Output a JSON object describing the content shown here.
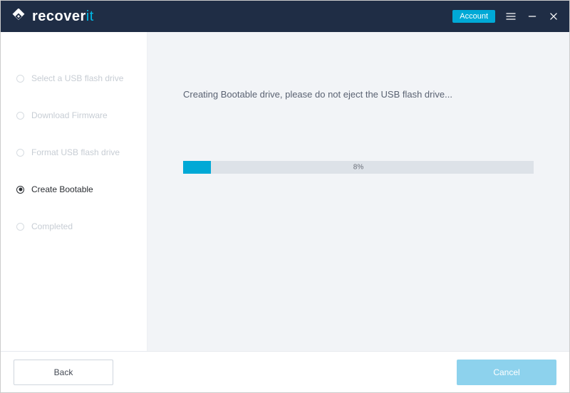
{
  "titlebar": {
    "logo_primary": "recover",
    "logo_accent": "it",
    "account_label": "Account"
  },
  "sidebar": {
    "items": [
      {
        "label": "Select a USB flash drive",
        "active": false
      },
      {
        "label": "Download Firmware",
        "active": false
      },
      {
        "label": "Format USB flash drive",
        "active": false
      },
      {
        "label": "Create Bootable",
        "active": true
      },
      {
        "label": "Completed",
        "active": false
      }
    ]
  },
  "main": {
    "status_text": "Creating Bootable drive, please do not eject the USB flash drive...",
    "progress_percent": 8,
    "progress_label": "8%"
  },
  "footer": {
    "back_label": "Back",
    "cancel_label": "Cancel"
  }
}
